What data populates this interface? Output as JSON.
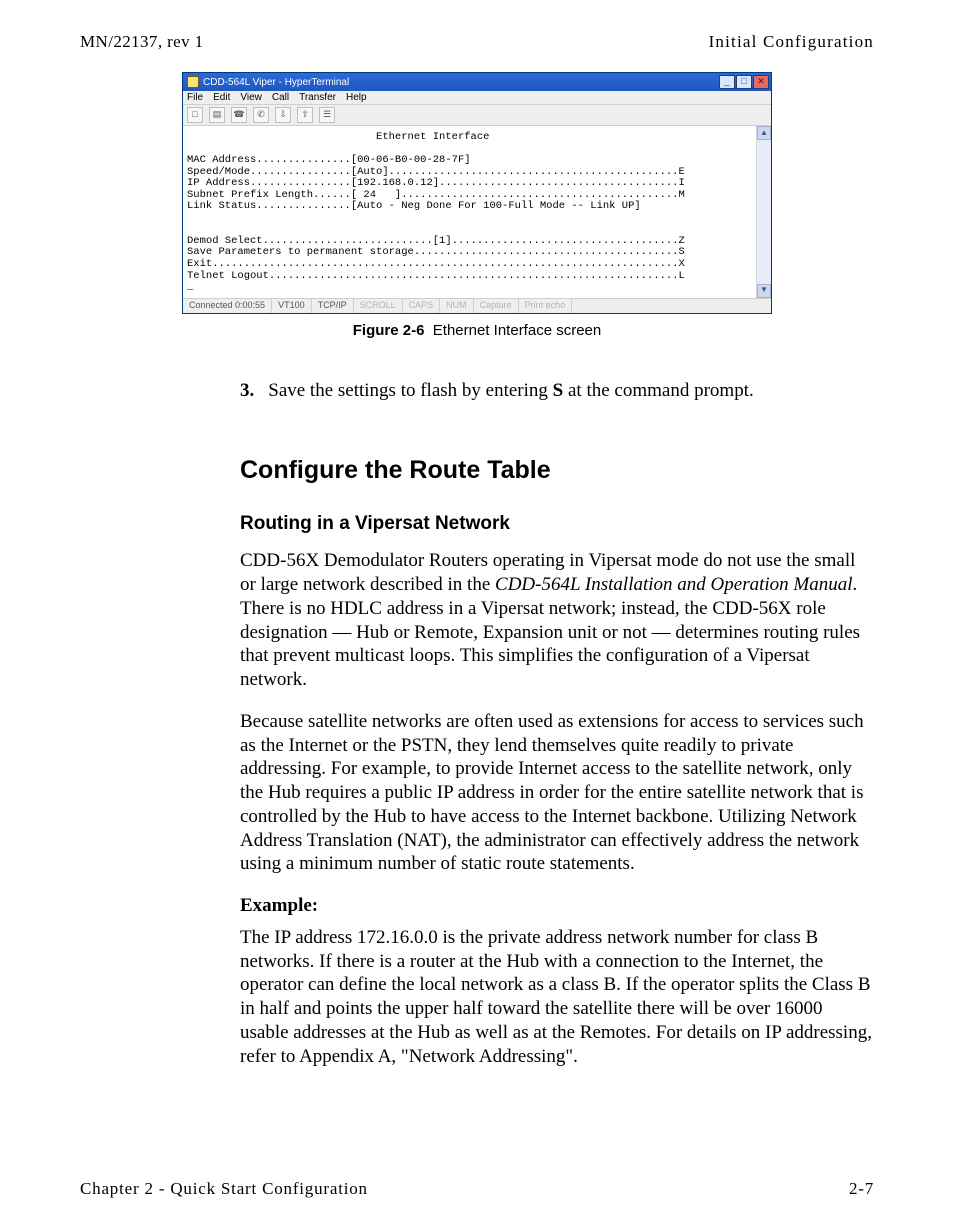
{
  "running_head": {
    "left": "MN/22137, rev 1",
    "right": "Initial Configuration"
  },
  "hyper": {
    "title": "CDD-564L Viper - HyperTerminal",
    "menu": [
      "File",
      "Edit",
      "View",
      "Call",
      "Transfer",
      "Help"
    ],
    "toolbar_icons": [
      "new-icon",
      "open-icon",
      "connect-icon",
      "disconnect-icon",
      "send-icon",
      "receive-icon",
      "properties-icon"
    ],
    "term_text": "                              Ethernet Interface\n\nMAC Address...............[00-06-B0-00-28-7F]\nSpeed/Mode................[Auto]..............................................E\nIP Address................[192.168.0.12]......................................I\nSubnet Prefix Length......[ 24   ]............................................M\nLink Status...............[Auto - Neg Done For 100-Full Mode -- Link UP]\n\n\nDemod Select...........................[1]....................................Z\nSave Parameters to permanent storage..........................................S\nExit..........................................................................X\nTelnet Logout.................................................................L\n_",
    "status": {
      "conn": "Connected 0:00:55",
      "emul": "VT100",
      "proto": "TCP/IP",
      "p1": "SCROLL",
      "p2": "CAPS",
      "p3": "NUM",
      "p4": "Capture",
      "p5": "Print echo"
    }
  },
  "figure": {
    "label": "Figure 2-6",
    "caption": "Ethernet Interface screen"
  },
  "step3": {
    "num": "3.",
    "text_a": "Save the settings to flash by entering ",
    "text_s": "S",
    "text_b": " at the command prompt."
  },
  "section_h2": "Configure the Route Table",
  "section_h3": "Routing in a Vipersat Network",
  "para1a": "CDD-56X Demodulator Routers operating in Vipersat mode do not use the small or large network described in the ",
  "para1em": "CDD-564L Installation and Operation Manual",
  "para1b": ". There is no HDLC address in a Vipersat network; instead, the CDD-56X role designation — Hub or Remote, Expansion unit or not — determines routing rules that prevent multicast loops. This simplifies the configuration of a Vipersat network.",
  "para2": "Because satellite networks are often used as extensions for access to services such as the Internet or the PSTN, they lend themselves quite readily to private addressing. For example, to provide Internet access to the satellite network, only the Hub requires a public IP address in order for the entire satellite network that is controlled by the Hub to have access to the Internet backbone. Utilizing Network Address Translation (NAT), the administrator can effectively address the network using a minimum number of static route statements.",
  "example_label": "Example:",
  "para3": "The IP address 172.16.0.0 is the private address network number for class B networks. If there is a router at the Hub with a connection to the Internet, the operator can define the local network as a class B. If the operator splits the Class B in half and points the upper half toward the satellite there will be over 16000 usable addresses at the Hub as well as at the Remotes. For details on IP addressing, refer to Appendix A, \"Network Addressing\".",
  "footer": {
    "left": "Chapter 2 - Quick Start Configuration",
    "right": "2-7"
  }
}
